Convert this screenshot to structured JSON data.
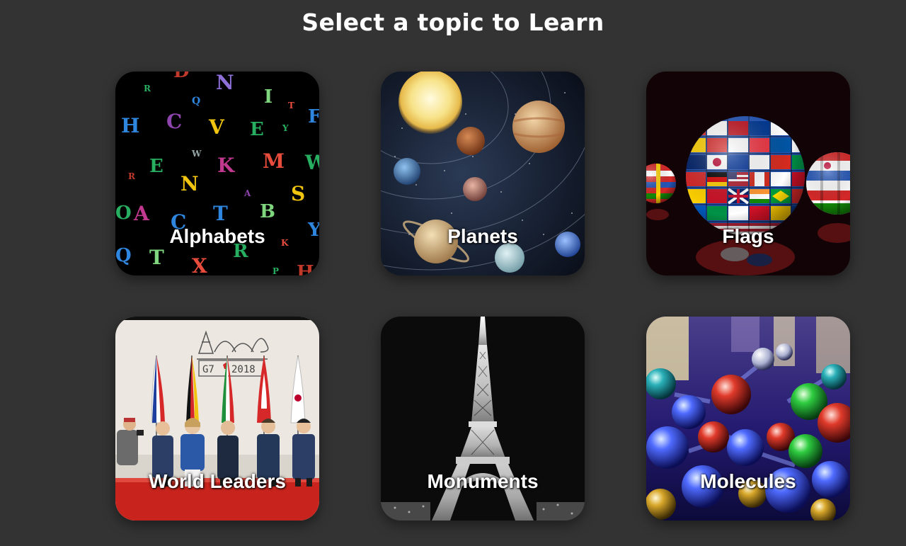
{
  "page": {
    "title": "Select a topic to Learn",
    "background_color": "#333333"
  },
  "topics": [
    {
      "label": "Alphabets",
      "image": "colorful-letters-image"
    },
    {
      "label": "Planets",
      "image": "solar-system-image"
    },
    {
      "label": "Flags",
      "image": "flag-spheres-image"
    },
    {
      "label": "World Leaders",
      "image": "g7-leaders-cartoon-image"
    },
    {
      "label": "Monuments",
      "image": "eiffel-tower-night-image"
    },
    {
      "label": "Molecules",
      "image": "glass-molecules-image"
    }
  ]
}
